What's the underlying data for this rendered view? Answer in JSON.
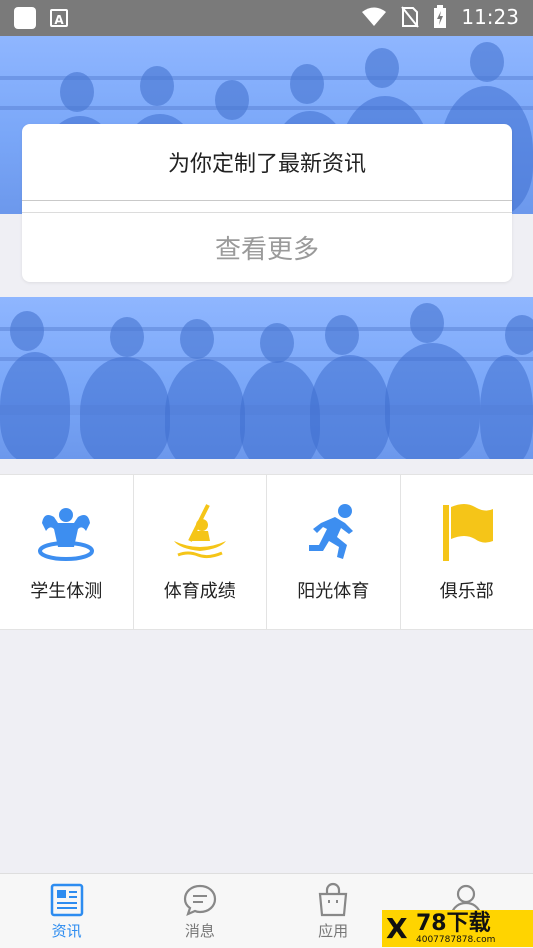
{
  "statusbar": {
    "time": "11:23",
    "app_badge": "A"
  },
  "banner": {
    "style": "blue-tint cheering crowd"
  },
  "notice_card": {
    "title": "为你定制了最新资讯",
    "more_label": "查看更多"
  },
  "quick_grid": {
    "items": [
      {
        "label": "学生体测",
        "icon": "muscle-man-icon"
      },
      {
        "label": "体育成绩",
        "icon": "kayak-icon"
      },
      {
        "label": "阳光体育",
        "icon": "running-man-icon"
      },
      {
        "label": "俱乐部",
        "icon": "flag-icon"
      }
    ],
    "accent_blue": "#3d8ef0",
    "accent_yellow": "#f5c518"
  },
  "tabbar": {
    "tabs": [
      {
        "label": "资讯",
        "icon": "news-icon",
        "active": true
      },
      {
        "label": "消息",
        "icon": "message-icon",
        "active": false
      },
      {
        "label": "应用",
        "icon": "bag-icon",
        "active": false
      },
      {
        "label": "",
        "icon": "user-icon",
        "active": false
      }
    ],
    "active_color": "#2d8cf0"
  },
  "watermark": {
    "main": "78下载",
    "sub": "4007787878.com",
    "mark": "X"
  }
}
